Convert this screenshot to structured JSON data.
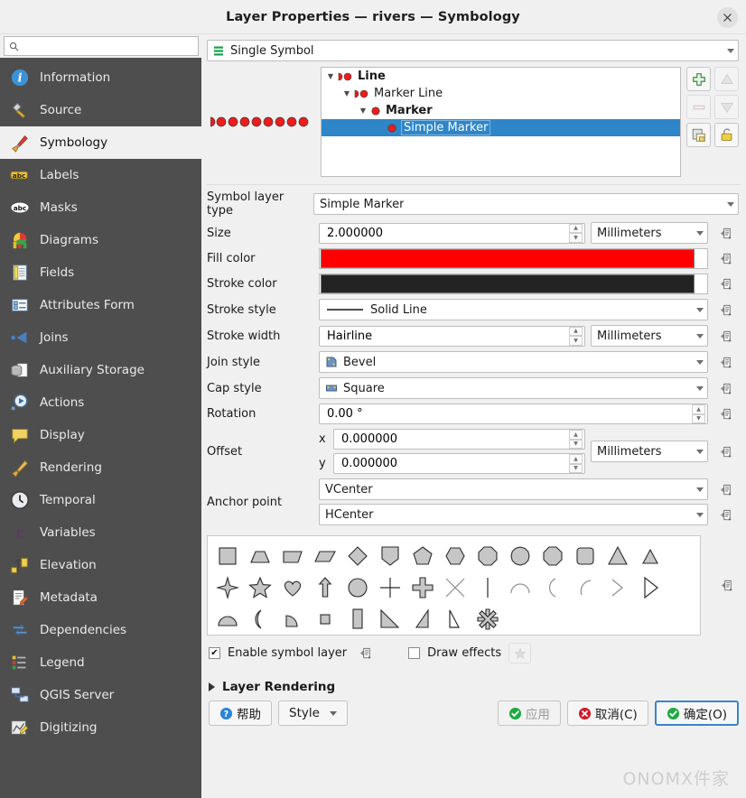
{
  "window": {
    "title": "Layer Properties — rivers — Symbology",
    "close_label": "✕"
  },
  "sidebar": {
    "search_placeholder": "",
    "search_value": "",
    "items": [
      {
        "label": "Information",
        "icon": "information-icon",
        "active": false
      },
      {
        "label": "Source",
        "icon": "source-icon",
        "active": false
      },
      {
        "label": "Symbology",
        "icon": "symbology-icon",
        "active": true
      },
      {
        "label": "Labels",
        "icon": "labels-icon",
        "active": false
      },
      {
        "label": "Masks",
        "icon": "masks-icon",
        "active": false
      },
      {
        "label": "Diagrams",
        "icon": "diagrams-icon",
        "active": false
      },
      {
        "label": "Fields",
        "icon": "fields-icon",
        "active": false
      },
      {
        "label": "Attributes Form",
        "icon": "attributes-form-icon",
        "active": false
      },
      {
        "label": "Joins",
        "icon": "joins-icon",
        "active": false
      },
      {
        "label": "Auxiliary Storage",
        "icon": "auxiliary-storage-icon",
        "active": false
      },
      {
        "label": "Actions",
        "icon": "actions-icon",
        "active": false
      },
      {
        "label": "Display",
        "icon": "display-icon",
        "active": false
      },
      {
        "label": "Rendering",
        "icon": "rendering-icon",
        "active": false
      },
      {
        "label": "Temporal",
        "icon": "temporal-icon",
        "active": false
      },
      {
        "label": "Variables",
        "icon": "variables-icon",
        "active": false
      },
      {
        "label": "Elevation",
        "icon": "elevation-icon",
        "active": false
      },
      {
        "label": "Metadata",
        "icon": "metadata-icon",
        "active": false
      },
      {
        "label": "Dependencies",
        "icon": "dependencies-icon",
        "active": false
      },
      {
        "label": "Legend",
        "icon": "legend-icon",
        "active": false
      },
      {
        "label": "QGIS Server",
        "icon": "qgis-server-icon",
        "active": false
      },
      {
        "label": "Digitizing",
        "icon": "digitizing-icon",
        "active": false
      }
    ]
  },
  "renderer": {
    "selected": "Single Symbol"
  },
  "symbol_tree": {
    "rows": [
      {
        "label": "Line",
        "depth": 0,
        "bold": true,
        "expanded": true,
        "selected": false,
        "icon": "line-marker-icon"
      },
      {
        "label": "Marker Line",
        "depth": 1,
        "bold": false,
        "expanded": true,
        "selected": false,
        "icon": "line-marker-icon"
      },
      {
        "label": "Marker",
        "depth": 2,
        "bold": true,
        "expanded": true,
        "selected": false,
        "icon": "dot-icon"
      },
      {
        "label": "Simple Marker",
        "depth": 3,
        "bold": false,
        "expanded": false,
        "selected": true,
        "icon": "dot-icon"
      }
    ],
    "tools": [
      {
        "name": "add-symbol-layer-button",
        "icon": "plus-icon",
        "enabled": true
      },
      {
        "name": "move-up-button",
        "icon": "triangle-up-icon",
        "enabled": false
      },
      {
        "name": "remove-symbol-layer-button",
        "icon": "minus-icon",
        "enabled": false
      },
      {
        "name": "move-down-button",
        "icon": "triangle-down-icon",
        "enabled": false
      },
      {
        "name": "duplicate-button",
        "icon": "copy-icon",
        "enabled": true
      },
      {
        "name": "lock-colors-button",
        "icon": "lock-icon",
        "enabled": true
      }
    ]
  },
  "form": {
    "symbol_layer_type_label": "Symbol layer type",
    "symbol_layer_type_value": "Simple Marker",
    "size_label": "Size",
    "size_value": "2.000000",
    "size_unit": "Millimeters",
    "fill_color_label": "Fill color",
    "fill_color_value": "#ff0000",
    "stroke_color_label": "Stroke color",
    "stroke_color_value": "#232323",
    "stroke_style_label": "Stroke style",
    "stroke_style_value": "Solid Line",
    "stroke_width_label": "Stroke width",
    "stroke_width_value": "Hairline",
    "stroke_width_unit": "Millimeters",
    "join_style_label": "Join style",
    "join_style_value": "Bevel",
    "cap_style_label": "Cap style",
    "cap_style_value": "Square",
    "rotation_label": "Rotation",
    "rotation_value": "0.00 °",
    "offset_label": "Offset",
    "offset_x_prefix": "x",
    "offset_x_value": "0.000000",
    "offset_y_prefix": "y",
    "offset_y_value": "0.000000",
    "offset_unit": "Millimeters",
    "anchor_point_label": "Anchor point",
    "anchor_vertical_value": "VCenter",
    "anchor_horizontal_value": "HCenter"
  },
  "shapes": {
    "rows": [
      [
        "square",
        "trapezoid",
        "parallelogram-right",
        "parallelogram-left",
        "diamond",
        "pentagon-shield",
        "pentagon",
        "hexagon",
        "octagon",
        "decagon",
        "rounded-square-oct",
        "rounded-square",
        "triangle",
        "equilateral-triangle"
      ],
      [
        "star-4",
        "star-5",
        "heart",
        "arrow",
        "circle",
        "cross",
        "cross-fill",
        "cross2",
        "line",
        "half-arc",
        "quarter-arc",
        "third-arc",
        "angled-cross",
        "right-half-triangle"
      ],
      [
        "semicircle",
        "crescent",
        "quarter-circle",
        "small-square",
        "rectangle",
        "right-triangle-se",
        "right-triangle-sw",
        "thin-triangle",
        "asterisk-fill"
      ]
    ]
  },
  "footer": {
    "enable_symbol_layer_label": "Enable symbol layer",
    "enable_symbol_layer_checked": true,
    "draw_effects_label": "Draw effects",
    "draw_effects_checked": false,
    "layer_rendering_label": "Layer Rendering",
    "help_label": "帮助",
    "style_label": "Style",
    "apply_label": "应用",
    "cancel_label": "取消(C)",
    "ok_label": "确定(O)",
    "watermark": "ONOMX件家"
  },
  "colors": {
    "selection_blue": "#2e86c8",
    "sidebar_bg": "#4e4e4e",
    "dialog_bg": "#f0f0f0",
    "fill_red": "#ff0000",
    "stroke_dark": "#232323"
  }
}
